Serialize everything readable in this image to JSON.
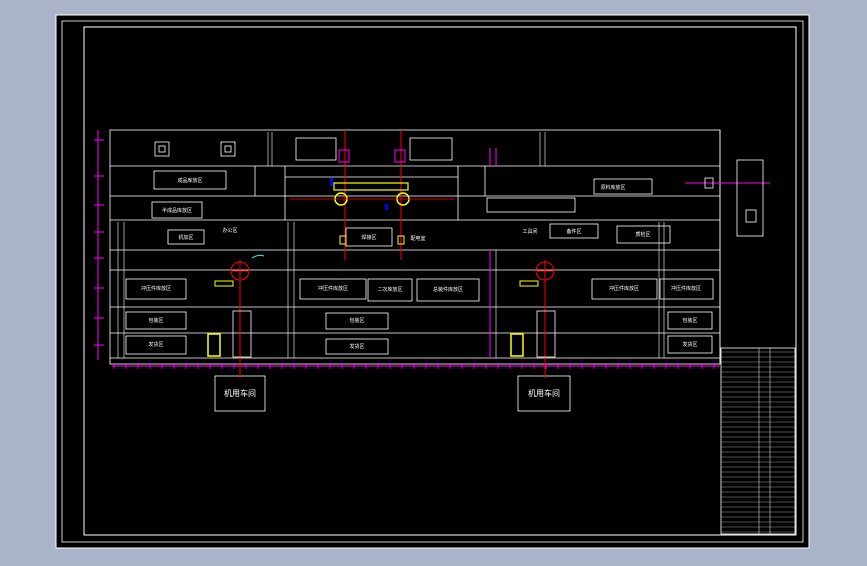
{
  "drawing": {
    "upper_rooms": [
      {
        "id": "r1",
        "text": "成品库放区"
      },
      {
        "id": "r2",
        "text": "原料库放区"
      },
      {
        "id": "r3",
        "text": "半成品库放区"
      },
      {
        "id": "r4",
        "text": "机加区"
      },
      {
        "id": "r5",
        "text": "焊接区"
      },
      {
        "id": "r6",
        "text": "备件区"
      },
      {
        "id": "r7",
        "text": "工具间"
      },
      {
        "id": "r8",
        "text": "质检区"
      },
      {
        "id": "r9",
        "text": "配电室"
      },
      {
        "id": "r10",
        "text": "办公区"
      }
    ],
    "mid_rooms": [
      {
        "id": "m1",
        "text": "冲压件库放区"
      },
      {
        "id": "m2",
        "text": "冲压件库放区"
      },
      {
        "id": "m3",
        "text": "二次库放区"
      },
      {
        "id": "m4",
        "text": "总装件库放区"
      },
      {
        "id": "m5",
        "text": "冲压件库放区"
      },
      {
        "id": "m6",
        "text": "冲压件库放区"
      }
    ],
    "lower_rooms": [
      {
        "id": "l1",
        "text": "包装区"
      },
      {
        "id": "l2",
        "text": "包装区"
      },
      {
        "id": "l3",
        "text": "包装区"
      },
      {
        "id": "l4",
        "text": "发货区"
      },
      {
        "id": "l5",
        "text": "发货区"
      },
      {
        "id": "l6",
        "text": "发货区"
      }
    ],
    "workshops": [
      {
        "id": "w1",
        "text": "机用车间"
      },
      {
        "id": "w2",
        "text": "机用车间"
      }
    ],
    "colors": {
      "background": "#000000",
      "frame": "#ffffff",
      "dimension": "#ff00ff",
      "equipment_red": "#ff0000",
      "equipment_yellow": "#ffff00",
      "blue": "#0000ff"
    }
  }
}
